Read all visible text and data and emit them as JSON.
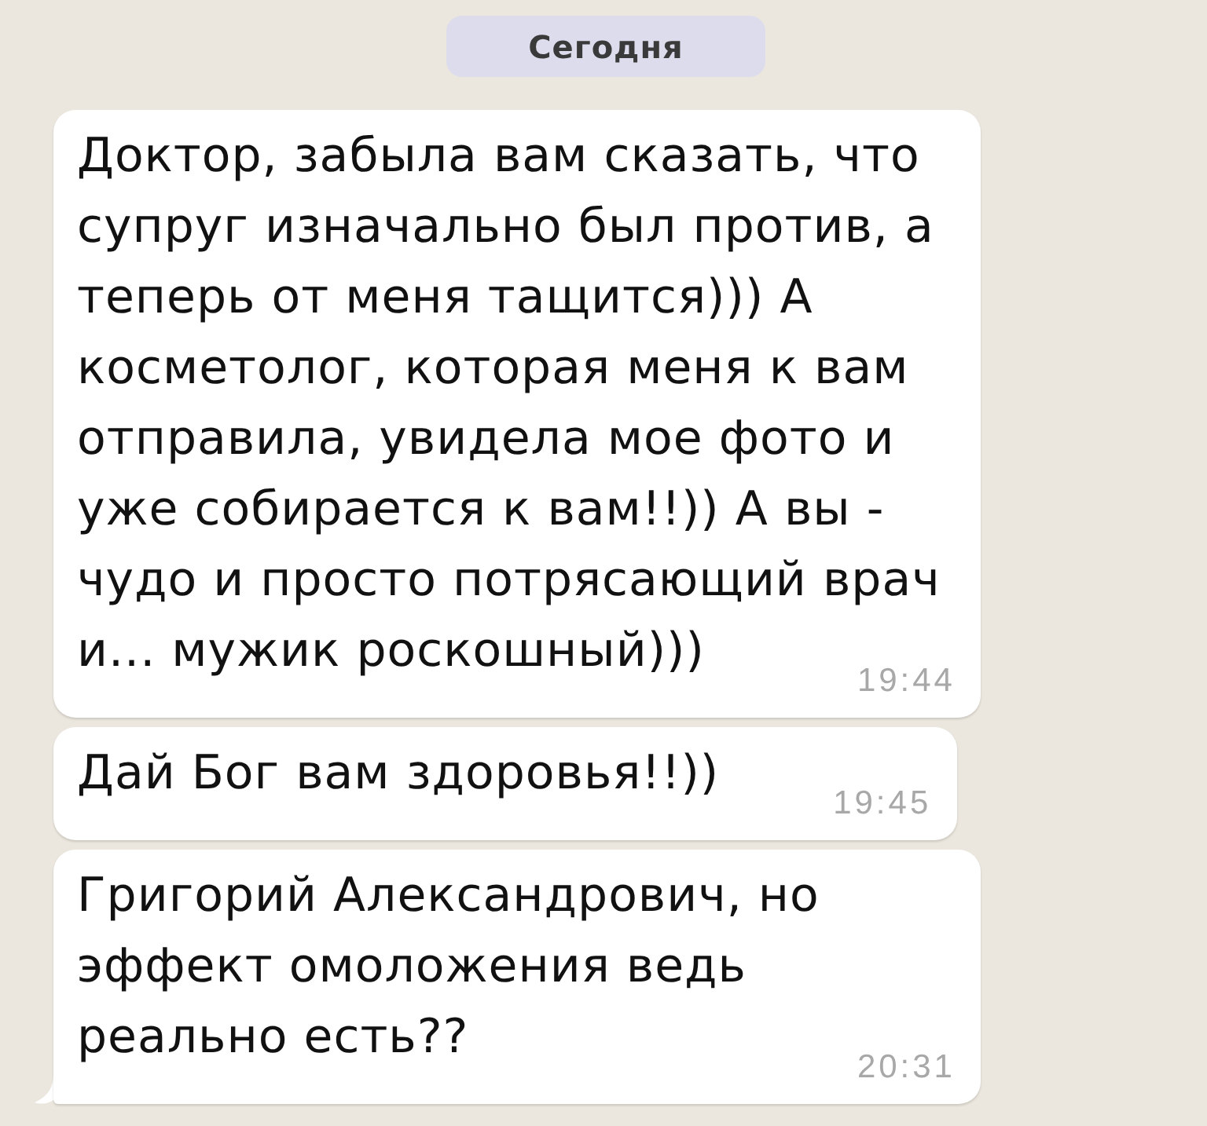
{
  "date_separator": {
    "label": "Сегодня"
  },
  "messages": [
    {
      "text": "Доктор, забыла вам сказать, что супруг изначально был против, а теперь от меня тащится))) А косметолог, которая меня к вам отправила, увидела мое фото и уже собирается к вам!!)) А вы - чудо и просто потрясающий врач и... мужик роскошный)))",
      "time": "19:44",
      "tail": false
    },
    {
      "text": "Дай Бог вам здоровья!!))",
      "time": "19:45",
      "tail": false
    },
    {
      "text": "Григорий Александрович, но эффект омоложения ведь реально есть??",
      "time": "20:31",
      "tail": true
    }
  ]
}
